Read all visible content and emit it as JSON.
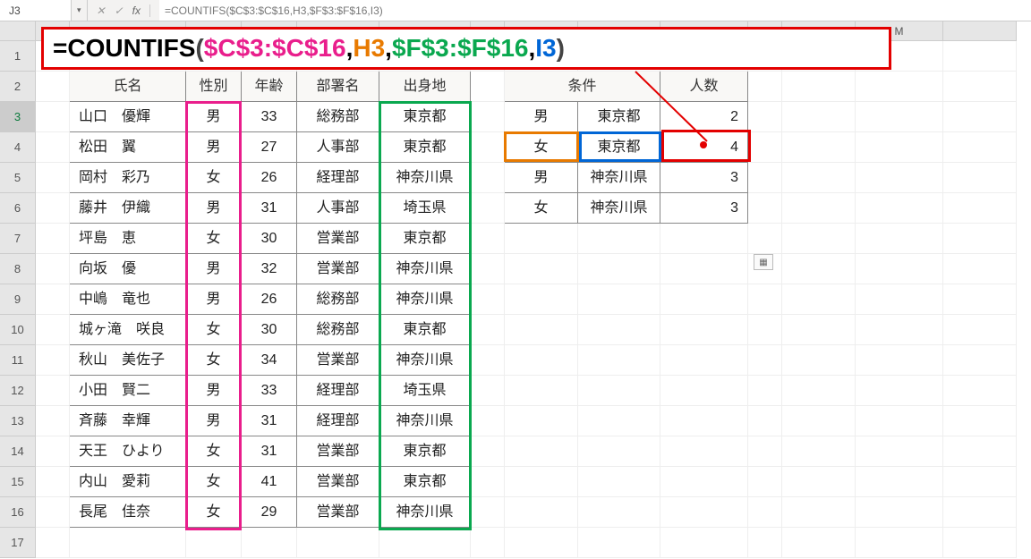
{
  "namebox": "J3",
  "formula_bar": "=COUNTIFS($C$3:$C$16,H3,$F$3:$F$16,I3)",
  "big_formula": {
    "eq": "=",
    "fn": "COUNTIFS",
    "lp": "(",
    "r1": "$C$3:$C$16",
    "c1": ",",
    "r2": "H3",
    "c2": ",",
    "r3": "$F$3:$F$16",
    "c3": ",",
    "r4": "I3",
    "rp": ")"
  },
  "col_labels": {
    "M": "M"
  },
  "row_labels": [
    "1",
    "2",
    "3",
    "4",
    "5",
    "6",
    "7",
    "8",
    "9",
    "10",
    "11",
    "12",
    "13",
    "14",
    "15",
    "16",
    "17"
  ],
  "headers": {
    "name": "氏名",
    "gender": "性別",
    "age": "年齢",
    "dept": "部署名",
    "origin": "出身地",
    "cond": "条件",
    "count": "人数"
  },
  "people": [
    {
      "name": "山口　優輝",
      "gender": "男",
      "age": 33,
      "dept": "総務部",
      "origin": "東京都"
    },
    {
      "name": "松田　翼",
      "gender": "男",
      "age": 27,
      "dept": "人事部",
      "origin": "東京都"
    },
    {
      "name": "岡村　彩乃",
      "gender": "女",
      "age": 26,
      "dept": "経理部",
      "origin": "神奈川県"
    },
    {
      "name": "藤井　伊織",
      "gender": "男",
      "age": 31,
      "dept": "人事部",
      "origin": "埼玉県"
    },
    {
      "name": "坪島　恵",
      "gender": "女",
      "age": 30,
      "dept": "営業部",
      "origin": "東京都"
    },
    {
      "name": "向坂　優",
      "gender": "男",
      "age": 32,
      "dept": "営業部",
      "origin": "神奈川県"
    },
    {
      "name": "中嶋　竜也",
      "gender": "男",
      "age": 26,
      "dept": "総務部",
      "origin": "神奈川県"
    },
    {
      "name": "城ヶ滝　咲良",
      "gender": "女",
      "age": 30,
      "dept": "総務部",
      "origin": "東京都"
    },
    {
      "name": "秋山　美佐子",
      "gender": "女",
      "age": 34,
      "dept": "営業部",
      "origin": "神奈川県"
    },
    {
      "name": "小田　賢二",
      "gender": "男",
      "age": 33,
      "dept": "経理部",
      "origin": "埼玉県"
    },
    {
      "name": "斉藤　幸輝",
      "gender": "男",
      "age": 31,
      "dept": "経理部",
      "origin": "神奈川県"
    },
    {
      "name": "天王　ひより",
      "gender": "女",
      "age": 31,
      "dept": "営業部",
      "origin": "東京都"
    },
    {
      "name": "内山　愛莉",
      "gender": "女",
      "age": 41,
      "dept": "営業部",
      "origin": "東京都"
    },
    {
      "name": "長尾　佳奈",
      "gender": "女",
      "age": 29,
      "dept": "営業部",
      "origin": "神奈川県"
    }
  ],
  "conditions": [
    {
      "gender": "男",
      "origin": "東京都",
      "count": 2
    },
    {
      "gender": "女",
      "origin": "東京都",
      "count": 4
    },
    {
      "gender": "男",
      "origin": "神奈川県",
      "count": 3
    },
    {
      "gender": "女",
      "origin": "神奈川県",
      "count": 3
    }
  ],
  "chart_data": {
    "type": "table",
    "title": "COUNTIFS example",
    "formula": "=COUNTIFS($C$3:$C$16,H3,$F$3:$F$16,I3)",
    "criteria_range1": "性別 (C3:C16)",
    "criteria1": "H3",
    "criteria_range2": "出身地 (F3:F16)",
    "criteria2": "I3",
    "results": [
      {
        "gender": "男",
        "origin": "東京都",
        "count": 2
      },
      {
        "gender": "女",
        "origin": "東京都",
        "count": 4
      },
      {
        "gender": "男",
        "origin": "神奈川県",
        "count": 3
      },
      {
        "gender": "女",
        "origin": "神奈川県",
        "count": 3
      }
    ]
  }
}
